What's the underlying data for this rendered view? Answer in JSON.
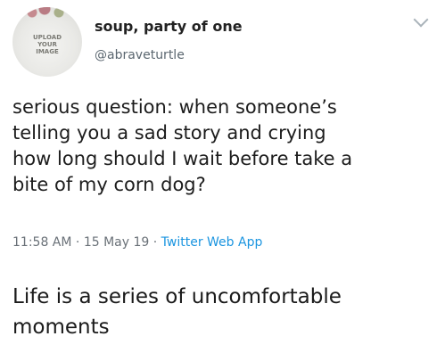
{
  "tweet": {
    "display_name": "soup, party of one",
    "handle": "@abraveturtle",
    "avatar_text": "UPLOAD YOUR IMAGE",
    "body": "serious question: when someone’s\ntelling you a sad story and crying\nhow long should I wait before take a\nbite of my corn dog?",
    "time": "11:58 AM",
    "date": "15 May 19",
    "source": "Twitter Web App",
    "separator": "·"
  },
  "caption": "Life is a series of uncomfortable\nmoments"
}
